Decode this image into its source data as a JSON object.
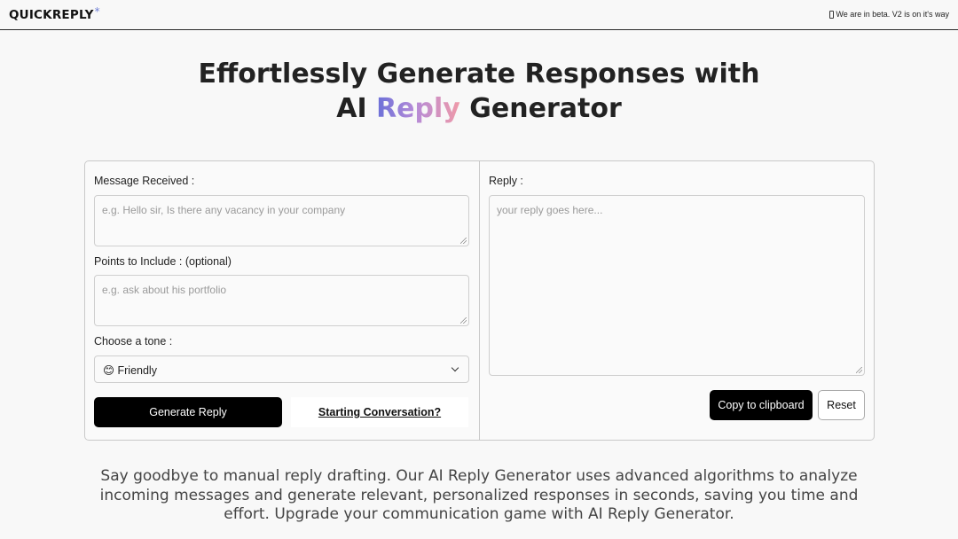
{
  "header": {
    "logo_text": "QUICKREPLY",
    "logo_mark": "*",
    "beta_notice": "We are in beta. V2 is on it's way",
    "beta_icon": "mobile-icon"
  },
  "hero": {
    "line1": "Effortlessly Generate Responses with",
    "line2_prefix": "AI ",
    "line2_highlight": "Reply",
    "line2_suffix": " Generator",
    "gradient_colors": [
      "#6a70d8",
      "#b48ad8",
      "#f09aa8"
    ]
  },
  "form": {
    "message_label": "Message Received :",
    "message_placeholder": "e.g. Hello sir, Is there any vacancy in your company",
    "points_label": "Points to Include : (optional)",
    "points_placeholder": "e.g. ask about his portfolio",
    "tone_label": "Choose a tone :",
    "tone_selected": "😊 Friendly",
    "generate_button": "Generate Reply",
    "starting_link": "Starting Conversation?"
  },
  "reply": {
    "label": "Reply :",
    "placeholder": "your reply goes here...",
    "copy_button": "Copy to clipboard",
    "reset_button": "Reset"
  },
  "description": "Say goodbye to manual reply drafting. Our AI Reply Generator uses advanced algorithms to analyze incoming messages and generate relevant, personalized responses in seconds, saving you time and effort. Upgrade your communication game with AI Reply Generator."
}
